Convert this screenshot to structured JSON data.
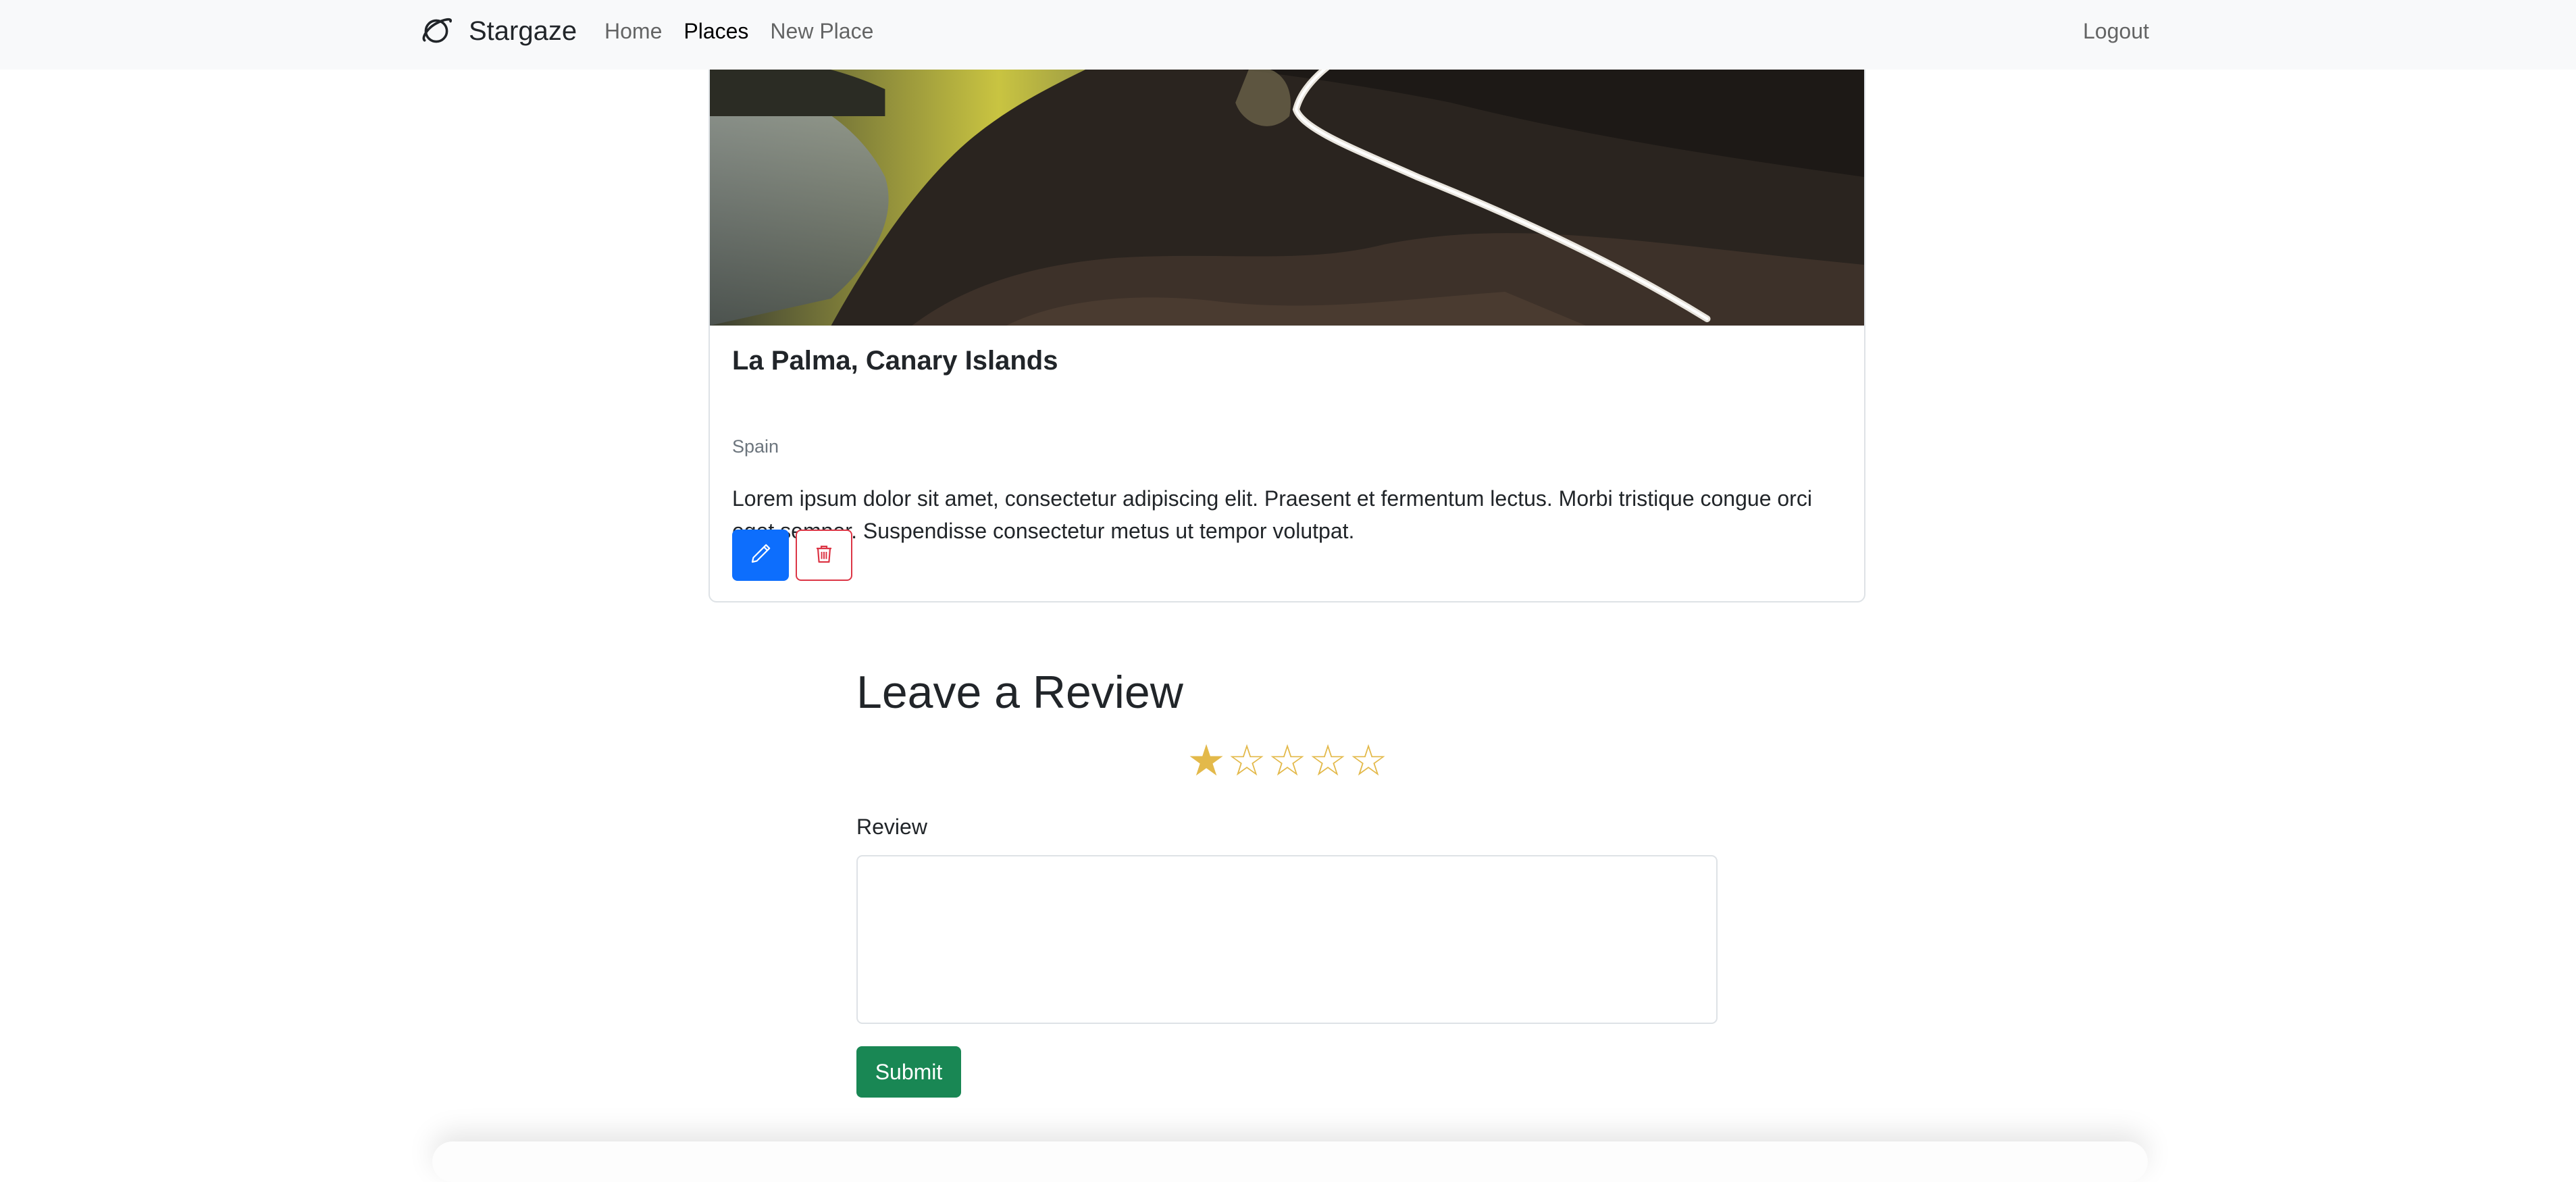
{
  "navbar": {
    "brand": "Stargaze",
    "brand_icon": "planet-icon",
    "links": [
      "Home",
      "Places",
      "New Place"
    ],
    "active_link": "Places",
    "logout": "Logout"
  },
  "place": {
    "title": "La Palma, Canary Islands",
    "location": "Spain",
    "description": "Lorem ipsum dolor sit amet, consectetur adipiscing elit. Praesent et fermentum lectus. Morbi tristique congue orci eget semper. Suspendisse consectetur metus ut tempor volutpat.",
    "image": "night-landscape-photo",
    "edit_icon": "pencil-icon",
    "delete_icon": "trash-icon"
  },
  "review": {
    "heading": "Leave a Review",
    "rating": 1,
    "rating_max": 5,
    "label": "Review",
    "textarea_value": "",
    "submit": "Submit"
  },
  "colors": {
    "primary": "#0d6efd",
    "danger": "#dc3545",
    "success": "#198754",
    "star": "#e3b94a",
    "navbar_bg": "#f8f9fa"
  }
}
